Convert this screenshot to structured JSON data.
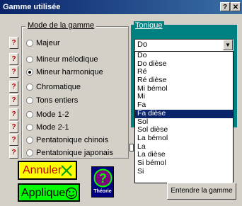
{
  "window": {
    "title": "Gamme utilisée",
    "help_btn": "?",
    "close_btn": "✕"
  },
  "mode_group": {
    "label": "Mode de la gamme",
    "help_label": "?",
    "options": [
      "Majeur",
      "Mineur mélodique",
      "Mineur harmonique",
      "Chromatique",
      "Tons entiers",
      "Mode 1-2",
      "Mode 2-1",
      "Pentatonique chinois",
      "Pentatonique japonais"
    ],
    "selected": "Mineur harmonique"
  },
  "tonique": {
    "label": "Tonique",
    "value": "Do",
    "options": [
      "Do",
      "Do dièse",
      "Ré",
      "Ré dièse",
      "Mi bémol",
      "Mi",
      "Fa",
      "Fa dièse",
      "Sol",
      "Sol dièse",
      "La bémol",
      "La",
      "La dièse",
      "Si bémol",
      "Si"
    ],
    "highlighted": "Fa dièse"
  },
  "buttons": {
    "annuler": "Annuler",
    "appliquer": "Appliquer",
    "theorie": "Théorie",
    "theorie_glyph": "?",
    "entendre": "Entendre la gamme"
  },
  "icons": {
    "cancel": "cross-icon",
    "apply": "smiley-icon",
    "help": "question-icon"
  },
  "colors": {
    "title_bar": "#0a246a",
    "tonique_panel": "#008080",
    "cancel_bg": "#ffff00",
    "apply_bg": "#00ff00",
    "theorie_circle": "#800080"
  }
}
